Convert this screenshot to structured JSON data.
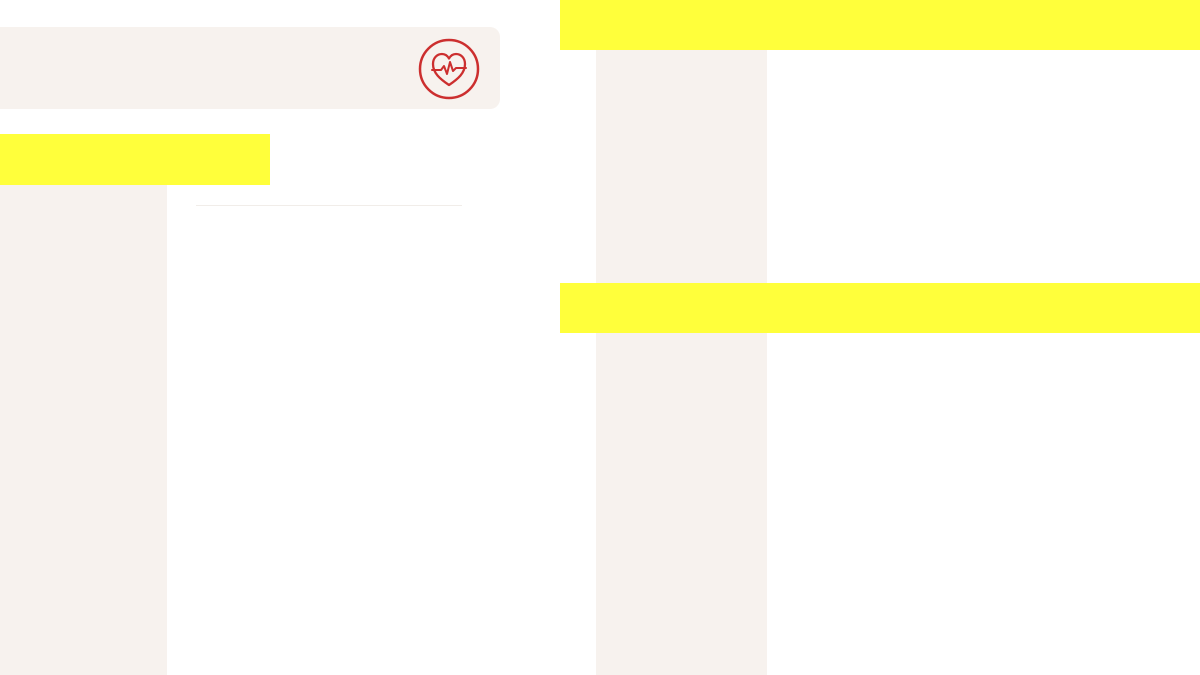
{
  "header": {
    "icon": "heart-pulse-icon"
  },
  "colors": {
    "highlight": "#ffff3b",
    "panel": "#f7f2ee",
    "icon": "#cc2f2f",
    "background": "#ffffff"
  }
}
